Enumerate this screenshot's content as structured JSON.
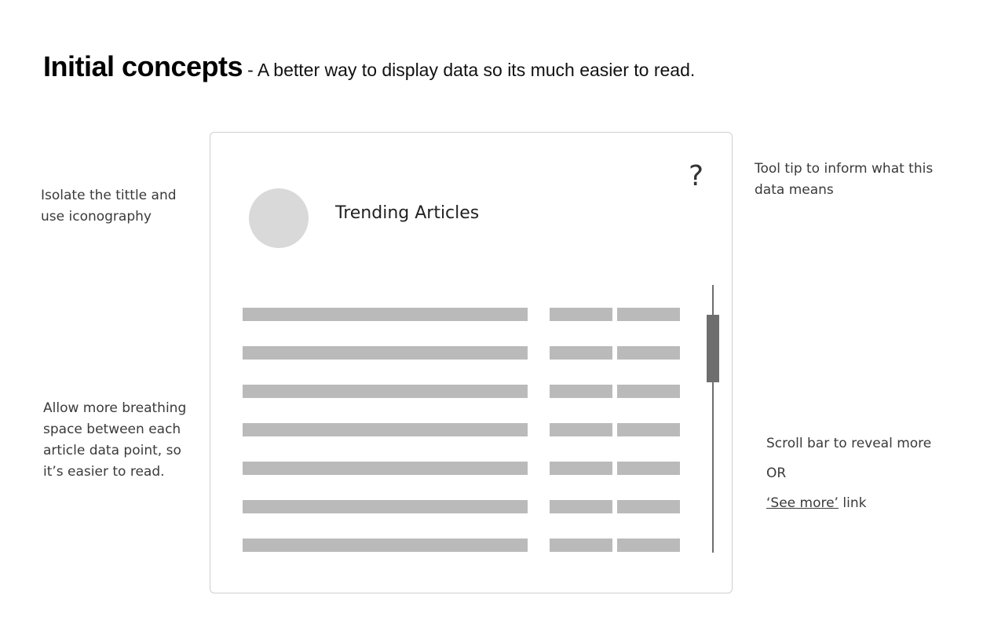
{
  "header": {
    "title": "Initial concepts",
    "subtitle": "- A better way to display data so its much easier to read."
  },
  "annotations": {
    "title_note": "Isolate the tittle and use iconography",
    "spacing_note": "Allow more breathing space between each article data point, so it’s easier to read.",
    "tooltip_note": "Tool tip to inform what this data means",
    "scroll_note": {
      "line1": "Scroll bar to reveal more",
      "line2": "OR",
      "link_text": "‘See more’",
      "link_suffix": " link"
    }
  },
  "card": {
    "title": "Trending Articles",
    "help_glyph": "?",
    "row_count": 7
  },
  "colors": {
    "placeholder_bar": "#bababa",
    "avatar": "#d9d9d9",
    "scrollbar": "#6e6e6e",
    "card_border": "#cfcfcf"
  }
}
